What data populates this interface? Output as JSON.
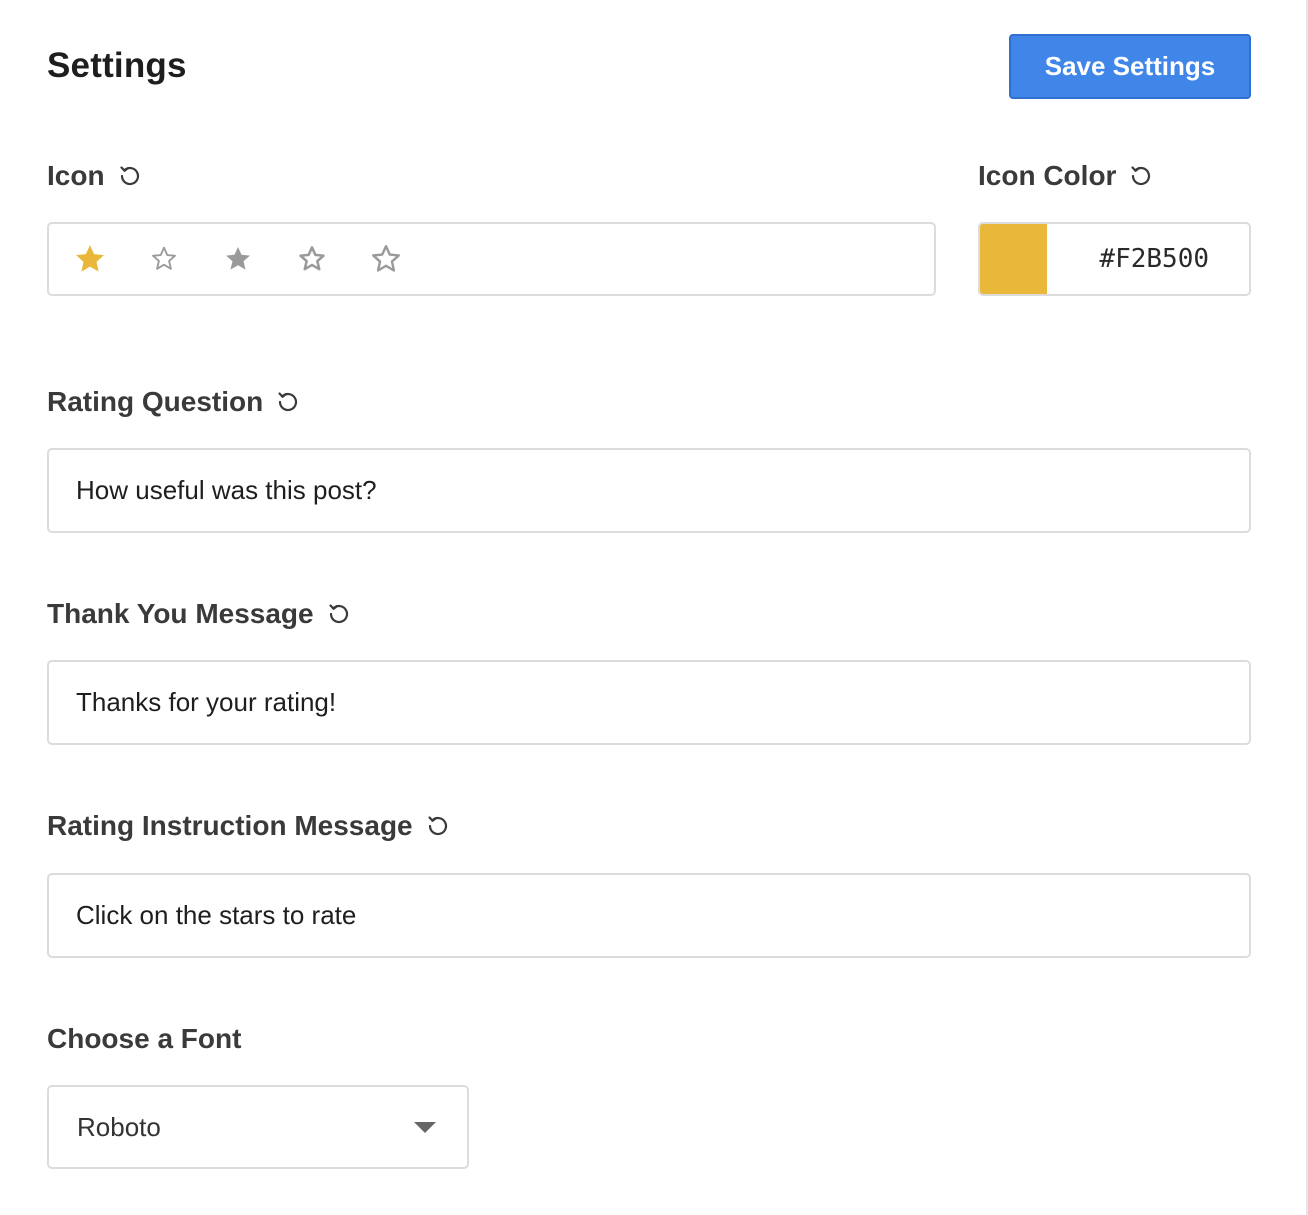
{
  "header": {
    "title": "Settings",
    "save_label": "Save Settings"
  },
  "icon": {
    "label": "Icon",
    "options": [
      {
        "icon": "star-filled-icon",
        "selected": true
      },
      {
        "icon": "star-thin-outline-icon",
        "selected": false
      },
      {
        "icon": "star-solid-icon",
        "selected": false
      },
      {
        "icon": "star-outline-icon",
        "selected": false
      },
      {
        "icon": "star-rounded-outline-icon",
        "selected": false
      }
    ]
  },
  "icon_color": {
    "label": "Icon Color",
    "value": "#F2B500",
    "swatch_color": "#E9B83A"
  },
  "rating_question": {
    "label": "Rating Question",
    "value": "How useful was this post?"
  },
  "thank_you": {
    "label": "Thank You Message",
    "value": "Thanks for your rating!"
  },
  "instruction": {
    "label": "Rating Instruction Message",
    "value": "Click on the stars to rate"
  },
  "font": {
    "label": "Choose a Font",
    "selected": "Roboto"
  },
  "colors": {
    "accent": "#3F86E8",
    "star_selected": "#E9B83A",
    "star_default": "#9A9A9A",
    "border": "#DCDCDC"
  }
}
